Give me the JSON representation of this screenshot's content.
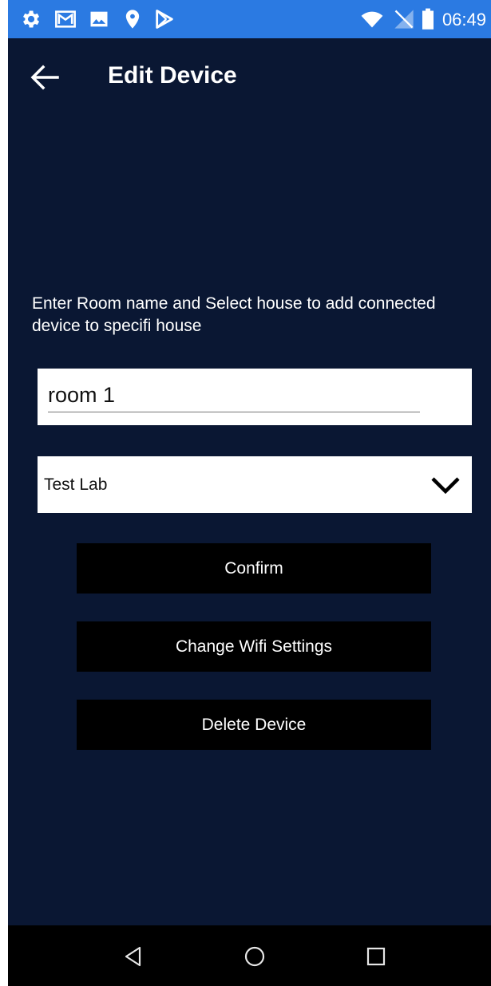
{
  "status_bar": {
    "time": "06:49",
    "left_icons": [
      "settings-icon",
      "gmail-icon",
      "photo-icon",
      "location-icon",
      "play-store-icon"
    ],
    "right_icons": [
      "wifi-icon",
      "no-sim-icon",
      "battery-icon"
    ],
    "background": "#2b7ae2"
  },
  "app_bar": {
    "title": "Edit Device",
    "back_icon": "arrow-back-icon"
  },
  "form": {
    "instruction": "Enter Room name and Select house to add connected device to specifi house",
    "room_name_value": "room 1",
    "house_selected": "Test Lab",
    "dropdown_icon": "chevron-down-icon"
  },
  "buttons": {
    "confirm": "Confirm",
    "change_wifi": "Change Wifi Settings",
    "delete": "Delete Device"
  },
  "nav_bar": {
    "icons": [
      "back-triangle-icon",
      "home-circle-icon",
      "recents-square-icon"
    ]
  },
  "colors": {
    "background": "#0a1733",
    "button": "#000000",
    "text": "#ffffff"
  }
}
